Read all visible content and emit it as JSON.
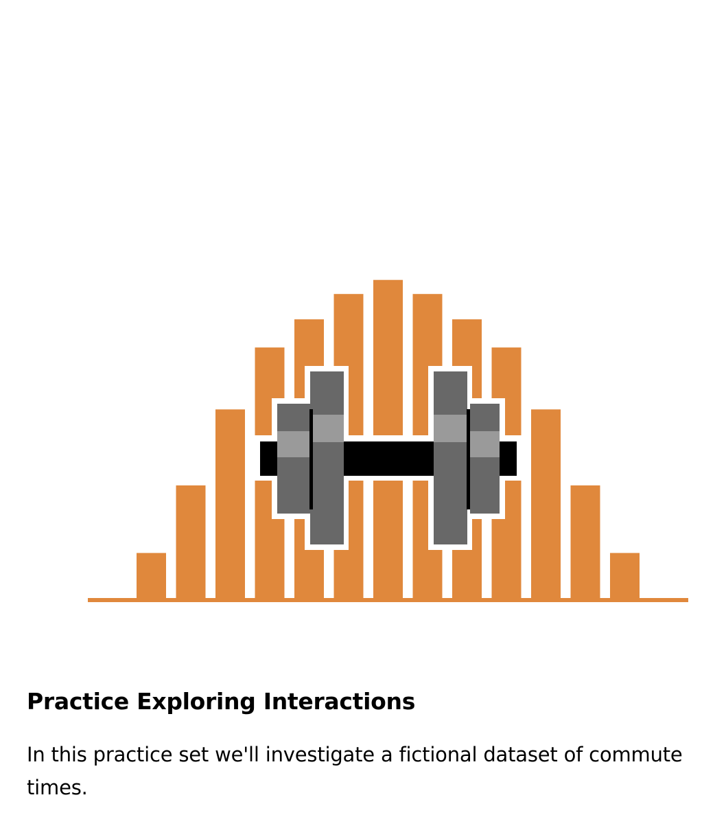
{
  "card": {
    "title": "Practice Exploring Interactions",
    "description": "In this practice set we'll investigate a fictional dataset of commute times."
  },
  "illustration": {
    "histogram_bar_levels": [
      0.16,
      0.4,
      0.67,
      0.89,
      0.99,
      1.08,
      1.13,
      1.08,
      0.99,
      0.89,
      0.67,
      0.4,
      0.16
    ],
    "colors": {
      "bars": "#E0883C",
      "bar_outline": "#ffffff",
      "plate_dark": "#686868",
      "plate_highlight": "#9A9A9A",
      "handle": "#000000"
    },
    "icon_names": [
      "histogram-icon",
      "dumbbell-icon"
    ]
  }
}
